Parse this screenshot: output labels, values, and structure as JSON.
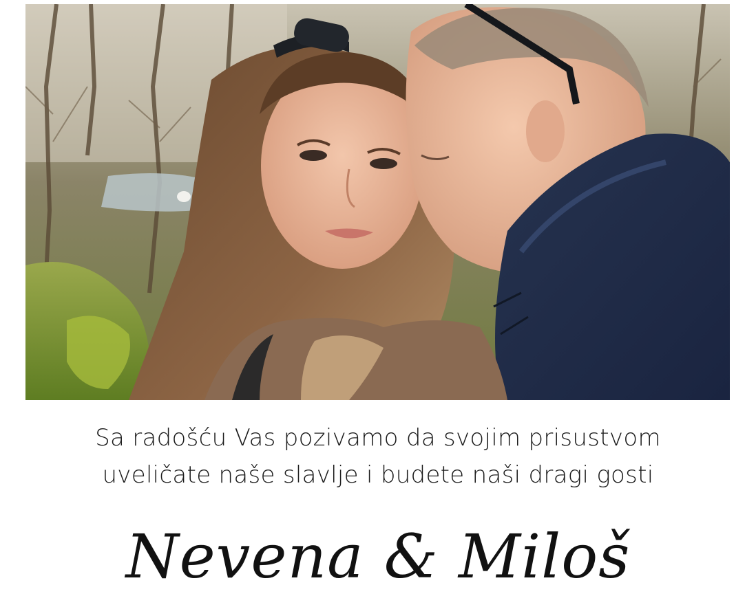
{
  "invitation": {
    "line1": "Sa radošću Vas pozivamo da svojim prisustvom",
    "line2": "uveličate naše slavlje i budete naši dragi gosti"
  },
  "couple": {
    "names": "Nevena & Miloš"
  },
  "photo": {
    "description_icon": "couple-photo"
  }
}
